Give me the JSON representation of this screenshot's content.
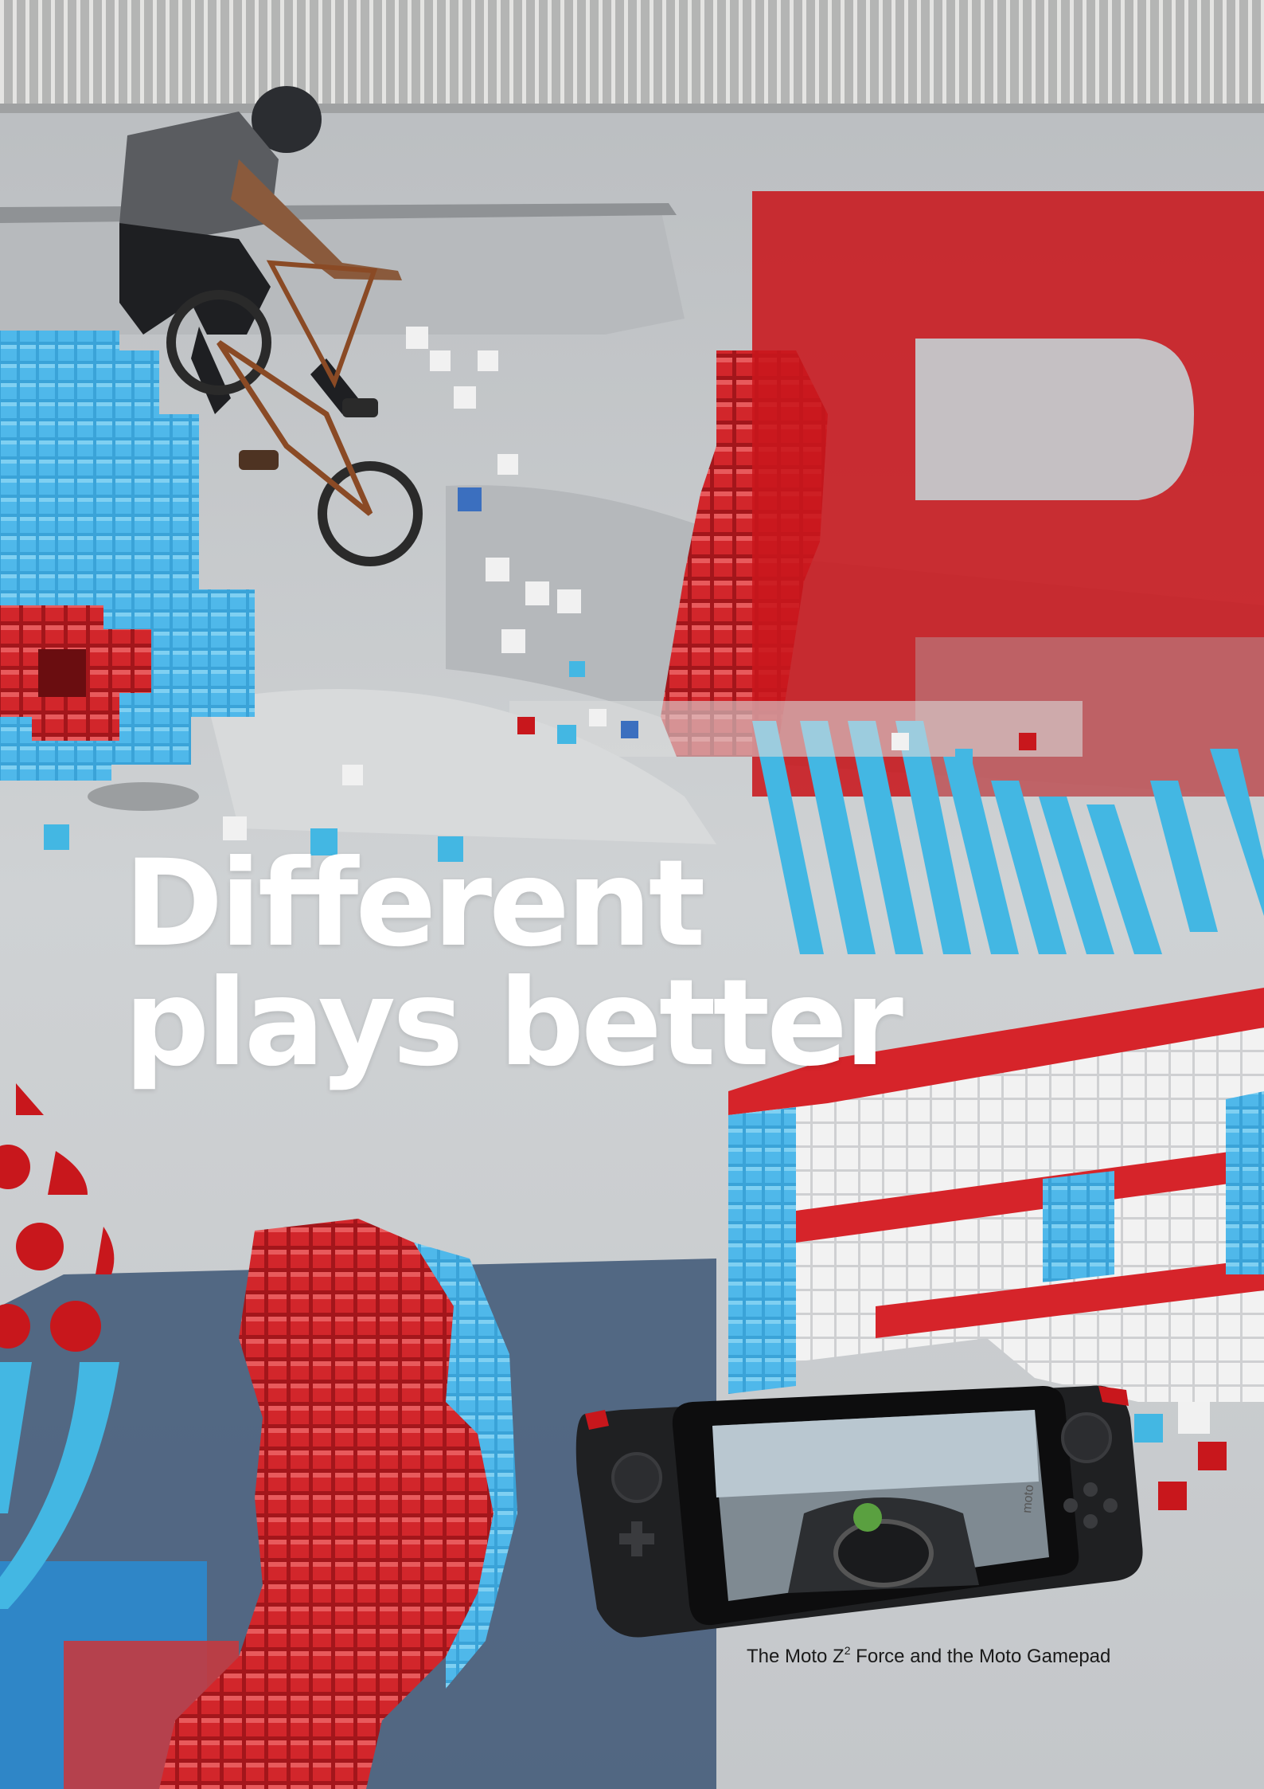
{
  "headline": {
    "line1": "Different",
    "line2": "plays better"
  },
  "caption": {
    "prefix": "The Moto Z",
    "superscript": "2",
    "suffix": " Force and the Moto Gamepad"
  },
  "phone_screen": {
    "brand_mark": "moto"
  },
  "colors": {
    "brand_red": "#c8171c",
    "brand_blue": "#43b7e3",
    "concrete": "#c9cccf",
    "white": "#ffffff"
  },
  "icons": [
    "bmx-rider-photo",
    "pixel-block-sculpture",
    "letter-b-graphic",
    "diagonal-stripes-graphic",
    "dot-pattern-graphic",
    "gamepad-phone-photo"
  ]
}
